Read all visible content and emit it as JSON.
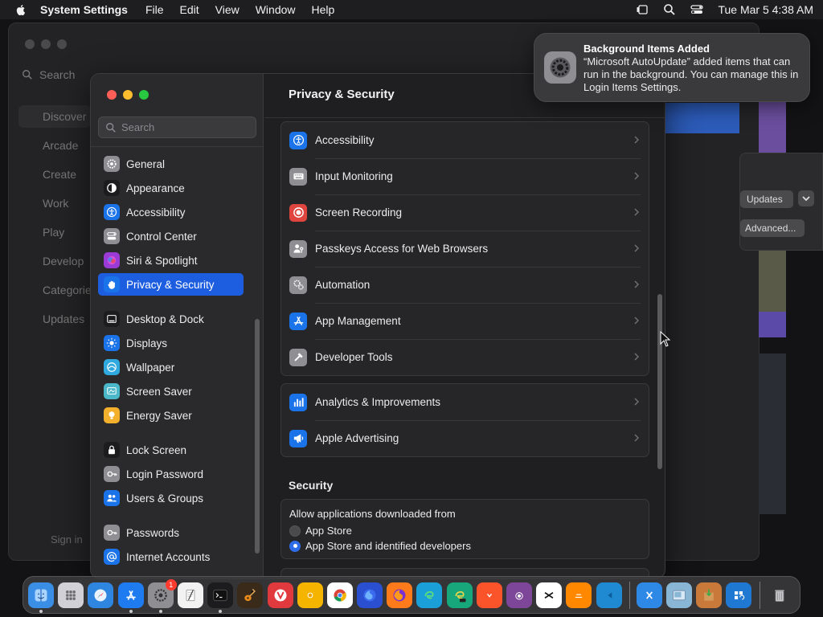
{
  "menubar": {
    "app_name": "System Settings",
    "menus": [
      "File",
      "Edit",
      "View",
      "Window",
      "Help"
    ],
    "datetime": "Tue Mar 5  4:38 AM"
  },
  "background_window": {
    "search_label": "Search",
    "sidebar": [
      "Discover",
      "Arcade",
      "Create",
      "Work",
      "Play",
      "Develop",
      "Categories",
      "Updates"
    ],
    "sign_in": "Sign in",
    "updates_button": "Updates",
    "advanced_button": "Advanced..."
  },
  "settings": {
    "search_placeholder": "Search",
    "sidebar_groups": [
      [
        {
          "label": "General",
          "icon": "gear-icon",
          "color": "#8e8e93"
        },
        {
          "label": "Appearance",
          "icon": "appearance-icon",
          "color": "#1c1c1e"
        },
        {
          "label": "Accessibility",
          "icon": "accessibility-icon",
          "color": "#1a73e8"
        },
        {
          "label": "Control Center",
          "icon": "control-center-icon",
          "color": "#8e8e93"
        },
        {
          "label": "Siri & Spotlight",
          "icon": "siri-icon",
          "color": "#9b3bd6"
        },
        {
          "label": "Privacy & Security",
          "icon": "hand-icon",
          "color": "#1a73e8",
          "selected": true
        }
      ],
      [
        {
          "label": "Desktop & Dock",
          "icon": "dock-icon",
          "color": "#1c1c1e"
        },
        {
          "label": "Displays",
          "icon": "sun-icon",
          "color": "#1a73e8"
        },
        {
          "label": "Wallpaper",
          "icon": "wallpaper-icon",
          "color": "#30a9de"
        },
        {
          "label": "Screen Saver",
          "icon": "screen-saver-icon",
          "color": "#4ab8c9"
        },
        {
          "label": "Energy Saver",
          "icon": "battery-icon",
          "color": "#f2b02c"
        }
      ],
      [
        {
          "label": "Lock Screen",
          "icon": "lock-icon",
          "color": "#1c1c1e"
        },
        {
          "label": "Login Password",
          "icon": "key-icon",
          "color": "#8e8e93"
        },
        {
          "label": "Users & Groups",
          "icon": "users-icon",
          "color": "#1a73e8"
        }
      ],
      [
        {
          "label": "Passwords",
          "icon": "key-icon",
          "color": "#8e8e93"
        },
        {
          "label": "Internet Accounts",
          "icon": "at-icon",
          "color": "#1a73e8"
        }
      ]
    ],
    "title": "Privacy & Security",
    "group1": [
      {
        "label": "Accessibility",
        "icon": "accessibility-icon",
        "color": "#1a73e8"
      },
      {
        "label": "Input Monitoring",
        "icon": "keyboard-icon",
        "color": "#8e8e93"
      },
      {
        "label": "Screen Recording",
        "icon": "record-icon",
        "color": "#e0443e"
      },
      {
        "label": "Passkeys Access for Web Browsers",
        "icon": "passkey-icon",
        "color": "#8e8e93"
      },
      {
        "label": "Automation",
        "icon": "gears-icon",
        "color": "#8e8e93"
      },
      {
        "label": "App Management",
        "icon": "app-store-icon",
        "color": "#1a73e8"
      },
      {
        "label": "Developer Tools",
        "icon": "hammer-icon",
        "color": "#8e8e93"
      }
    ],
    "group2": [
      {
        "label": "Analytics & Improvements",
        "icon": "chart-icon",
        "color": "#1a73e8"
      },
      {
        "label": "Apple Advertising",
        "icon": "megaphone-icon",
        "color": "#1a73e8"
      }
    ],
    "security": {
      "title": "Security",
      "label": "Allow applications downloaded from",
      "options": [
        {
          "label": "App Store",
          "selected": false
        },
        {
          "label": "App Store and identified developers",
          "selected": true
        }
      ]
    }
  },
  "notification": {
    "title": "Background Items Added",
    "body": "“Microsoft AutoUpdate” added items that can run in the background. You can manage this in Login Items Settings."
  },
  "dock": {
    "apps": [
      {
        "name": "finder-icon",
        "color": "#3a8ee6",
        "running": true
      },
      {
        "name": "launchpad-icon",
        "color": "#d0d0d6"
      },
      {
        "name": "safari-icon",
        "color": "#2f86e0"
      },
      {
        "name": "app-store-icon",
        "color": "#1f7cf0",
        "running": true
      },
      {
        "name": "system-settings-icon",
        "color": "#8e8e93",
        "badge": "1",
        "running": true
      },
      {
        "name": "textedit-icon",
        "color": "#f2f2f2"
      },
      {
        "name": "terminal-icon",
        "color": "#1c1c1e",
        "running": true
      },
      {
        "name": "garageband-icon",
        "color": "#3a2a1a"
      },
      {
        "name": "vivaldi-icon",
        "color": "#e0393e"
      },
      {
        "name": "chrome-canary-icon",
        "color": "#f5b400"
      },
      {
        "name": "chrome-icon",
        "color": "#ffffff"
      },
      {
        "name": "firefox-dev-icon",
        "color": "#2a4fd0"
      },
      {
        "name": "firefox-icon",
        "color": "#ff7a1a"
      },
      {
        "name": "edge-icon",
        "color": "#1a9fd9"
      },
      {
        "name": "edge-canary-icon",
        "color": "#17a77a"
      },
      {
        "name": "brave-icon",
        "color": "#fb542b"
      },
      {
        "name": "tor-icon",
        "color": "#7d4698"
      },
      {
        "name": "capcut-icon",
        "color": "#ffffff"
      },
      {
        "name": "vlc-icon",
        "color": "#ff8800"
      },
      {
        "name": "vscode-icon",
        "color": "#1f8ad2"
      },
      {
        "name": "xcode-icon",
        "color": "#2e89e6"
      },
      {
        "name": "preview-icon",
        "color": "#8ab6d6"
      },
      {
        "name": "installer-icon",
        "color": "#c97a3a"
      },
      {
        "name": "microsoft-autoupdate-icon",
        "color": "#1f78d1"
      }
    ],
    "trash": "trash-icon"
  }
}
